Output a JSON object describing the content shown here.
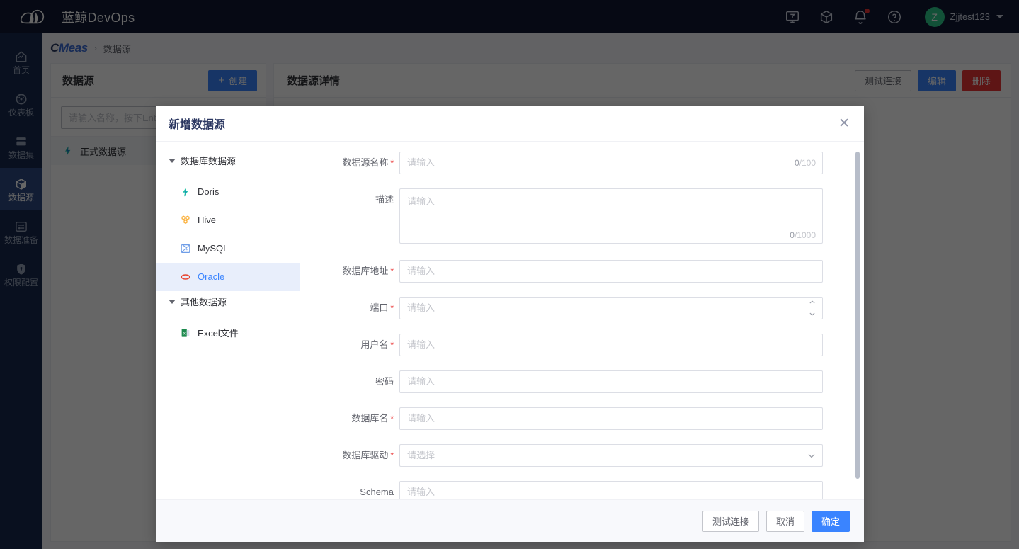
{
  "topbar": {
    "brand_name": "蓝鲸DevOps",
    "icons": [
      {
        "name": "monitor-icon",
        "title": "监控"
      },
      {
        "name": "cube-icon",
        "title": "应用"
      },
      {
        "name": "bell-icon",
        "title": "通知",
        "badge": true
      },
      {
        "name": "help-icon",
        "title": "帮助"
      }
    ],
    "user": {
      "initial": "Z",
      "name": "Zjjtest123",
      "avatar_color": "#2dcb8d"
    }
  },
  "rail": {
    "items": [
      {
        "label": "首页",
        "icon": "home-icon",
        "active": false
      },
      {
        "label": "仪表板",
        "icon": "dashboard-icon",
        "active": false
      },
      {
        "label": "数据集",
        "icon": "dataset-icon",
        "active": false
      },
      {
        "label": "数据源",
        "icon": "datasource-icon",
        "active": true
      },
      {
        "label": "数据准备",
        "icon": "data-prep-icon",
        "active": false
      },
      {
        "label": "权限配置",
        "icon": "permission-icon",
        "active": false
      }
    ]
  },
  "breadcrumb": {
    "product_c": "C",
    "product_meas": "Meas",
    "separator": "›",
    "current": "数据源"
  },
  "left_panel": {
    "title": "数据源",
    "create_label": "创建",
    "create_icon": "plus-icon",
    "search_placeholder": "请输入名称，按下Enter键搜索",
    "search_value": "",
    "items": [
      {
        "label": "正式数据源",
        "icon": "doris-icon"
      }
    ]
  },
  "right_panel": {
    "title": "数据源详情",
    "actions": [
      {
        "label": "测试连接",
        "style": "default"
      },
      {
        "label": "编辑",
        "style": "primary"
      },
      {
        "label": "删除",
        "style": "danger"
      }
    ]
  },
  "modal": {
    "title": "新增数据源",
    "close_icon": "close-icon",
    "tree": [
      {
        "group_label": "数据库数据源",
        "expanded": true,
        "nodes": [
          {
            "label": "Doris",
            "icon": "doris-icon",
            "selected": false
          },
          {
            "label": "Hive",
            "icon": "hive-icon",
            "selected": false
          },
          {
            "label": "MySQL",
            "icon": "mysql-icon",
            "selected": false
          },
          {
            "label": "Oracle",
            "icon": "oracle-icon",
            "selected": true
          }
        ]
      },
      {
        "group_label": "其他数据源",
        "expanded": true,
        "nodes": [
          {
            "label": "Excel文件",
            "icon": "excel-icon",
            "selected": false
          }
        ]
      }
    ],
    "form": [
      {
        "label": "数据源名称",
        "required": true,
        "type": "text",
        "placeholder": "请输入",
        "value": "",
        "counter_current": "0",
        "counter_max": "/100"
      },
      {
        "label": "描述",
        "required": false,
        "type": "textarea",
        "placeholder": "请输入",
        "value": "",
        "counter_current": "0",
        "counter_max": "/1000"
      },
      {
        "label": "数据库地址",
        "required": true,
        "type": "text",
        "placeholder": "请输入",
        "value": ""
      },
      {
        "label": "端口",
        "required": true,
        "type": "number",
        "placeholder": "请输入",
        "value": ""
      },
      {
        "label": "用户名",
        "required": true,
        "type": "text",
        "placeholder": "请输入",
        "value": ""
      },
      {
        "label": "密码",
        "required": false,
        "type": "password",
        "placeholder": "请输入",
        "value": ""
      },
      {
        "label": "数据库名",
        "required": true,
        "type": "text",
        "placeholder": "请输入",
        "value": ""
      },
      {
        "label": "数据库驱动",
        "required": true,
        "type": "select",
        "placeholder": "请选择",
        "value": ""
      },
      {
        "label": "Schema",
        "required": false,
        "type": "text",
        "placeholder": "请输入",
        "value": ""
      }
    ],
    "footer": [
      {
        "label": "测试连接",
        "style": "default"
      },
      {
        "label": "取消",
        "style": "default"
      },
      {
        "label": "确定",
        "style": "primary"
      }
    ]
  },
  "colors": {
    "topbar_bg": "#0f1834",
    "rail_bg": "#182a4e",
    "rail_active": "#2f4a82",
    "primary": "#3a84ff",
    "danger": "#ea3636",
    "avatar_green": "#2dcb8d",
    "oracle_red": "#e8422e",
    "hive_yellow": "#fbb03b",
    "doris_teal": "#21c2a5",
    "excel_green": "#1d8a4e"
  }
}
